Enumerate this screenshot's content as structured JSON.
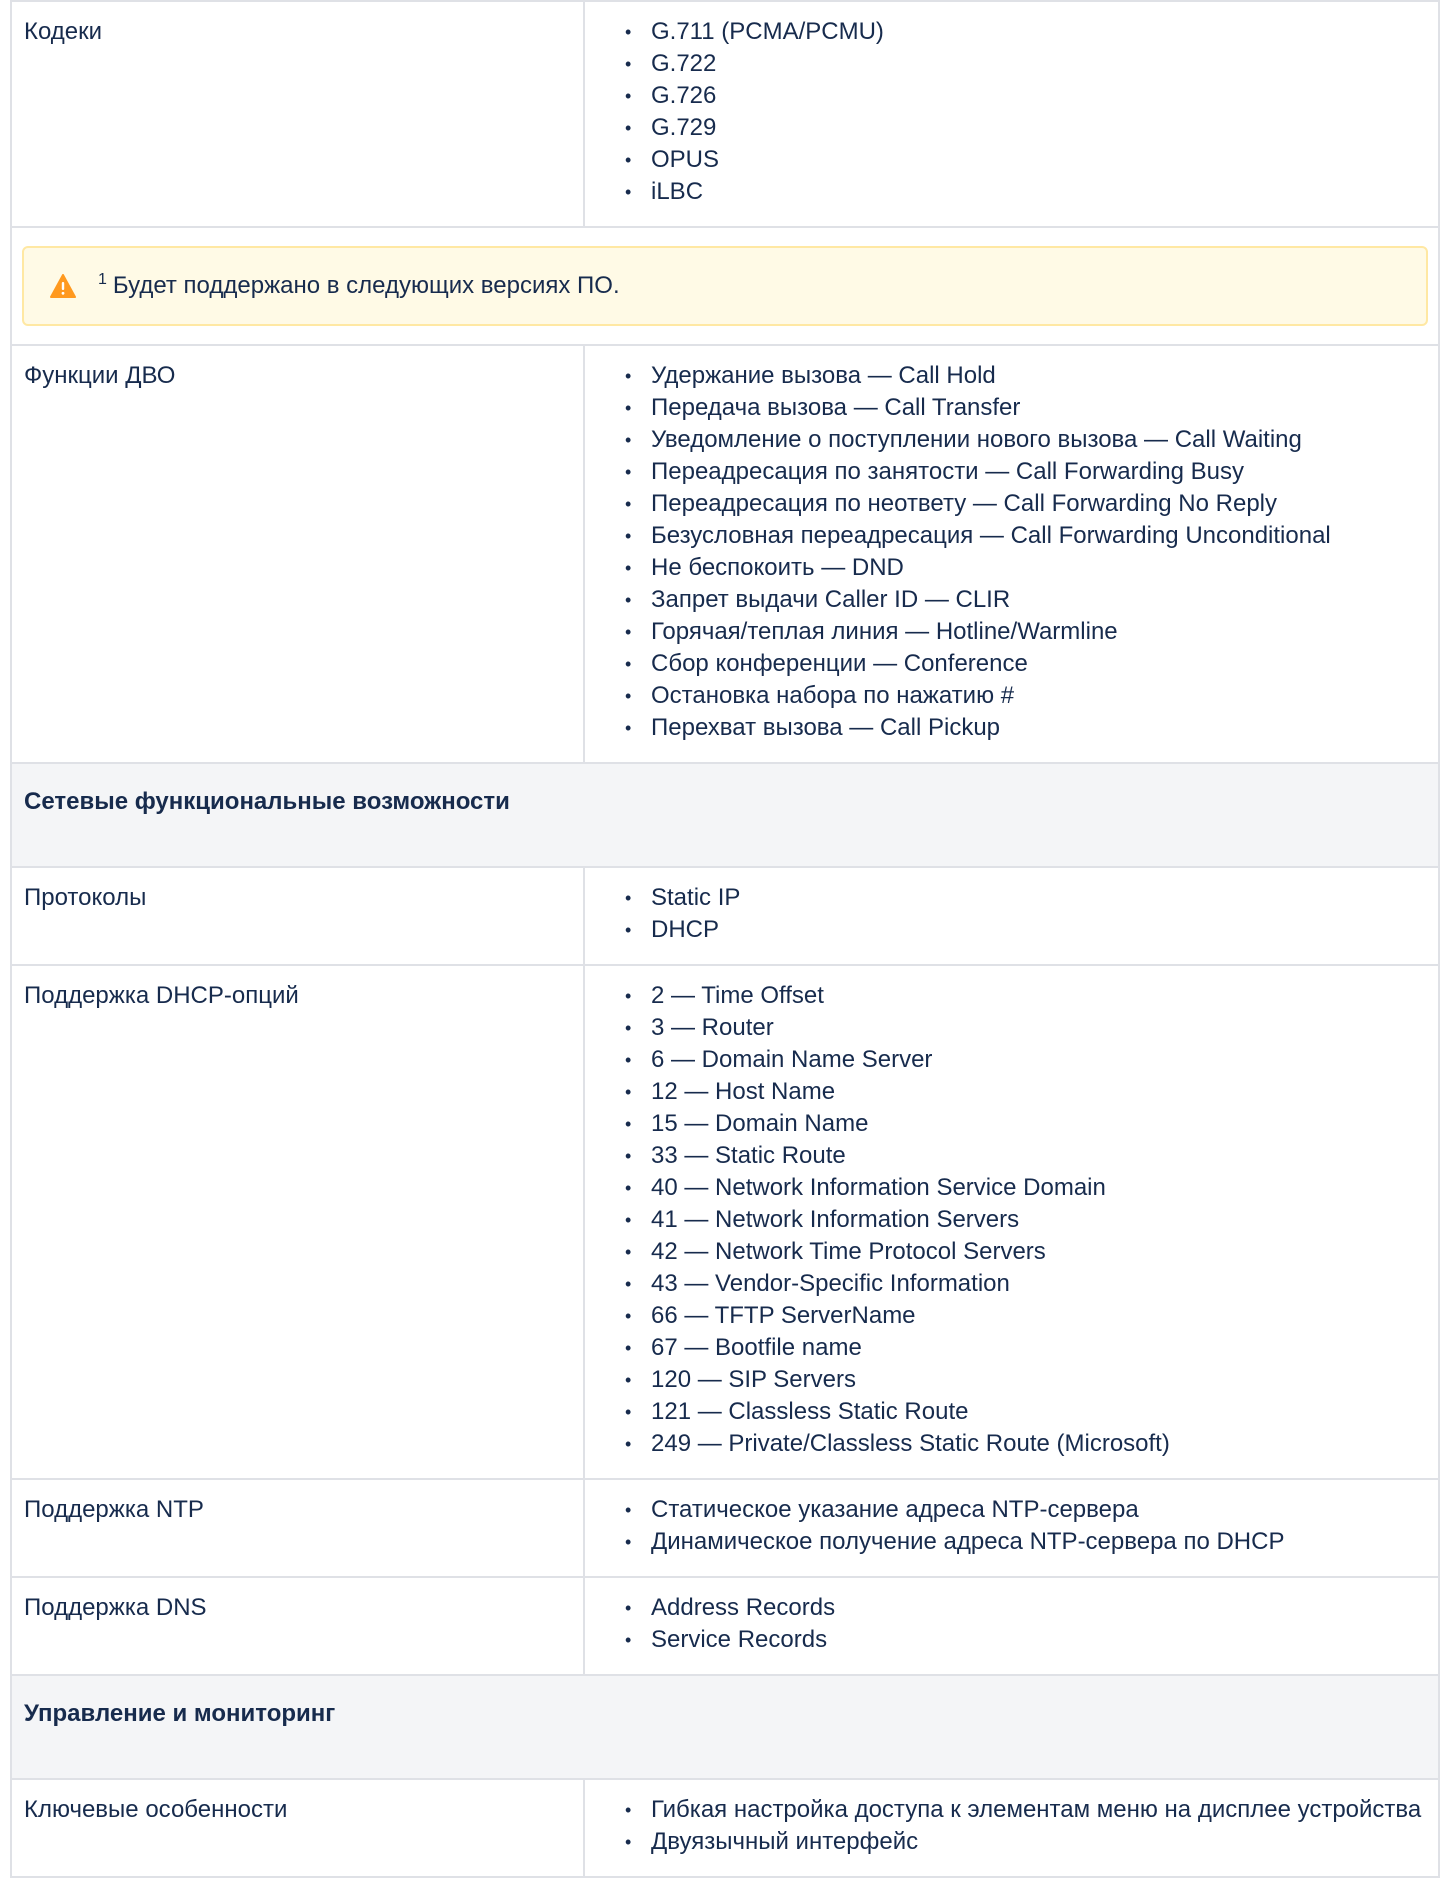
{
  "codecs": {
    "label": "Кодеки",
    "items": [
      "G.711 (PCMA/PCMU)",
      "G.722",
      "G.726",
      "G.729",
      "OPUS",
      "iLBC"
    ]
  },
  "note": {
    "marker": "1",
    "text": "Будет поддержано в следующих версиях ПО.",
    "icon": "warning-icon",
    "icon_color": "#ff991f",
    "background": "#fffae6"
  },
  "dvo": {
    "label": "Функции ДВО",
    "items": [
      "Удержание вызова — Call Hold",
      "Передача вызова — Call Transfer",
      "Уведомление о поступлении нового вызова — Call Waiting",
      "Переадресация по занятости — Call Forwarding Busy",
      "Переадресация по неответу — Call Forwarding No Reply",
      "Безусловная переадресация — Call Forwarding Unconditional",
      "Не беспокоить — DND",
      "Запрет выдачи Caller ID — CLIR",
      "Горячая/теплая линия — Hotline/Warmline",
      "Сбор конференции —  Conference",
      "Остановка набора по нажатию #",
      "Перехват вызова — Call Pickup"
    ]
  },
  "network_section": {
    "title": "Сетевые функциональные возможности"
  },
  "protocols": {
    "label": "Протоколы",
    "items": [
      "Static IP",
      "DHCP"
    ]
  },
  "dhcp_options": {
    "label": "Поддержка DHCP-опций",
    "items": [
      "2 — Time Offset",
      "3 — Router",
      "6 — Domain Name Server",
      "12 — Host Name",
      "15 — Domain Name",
      "33 — Static Route",
      "40 — Network Information Service Domain",
      "41 — Network Information Servers",
      "42 — Network Time Protocol Servers",
      "43 — Vendor-Specific Information",
      "66 — TFTP ServerName",
      "67 — Bootfile name",
      "120 — SIP Servers",
      "121 — Classless Static Route",
      "249 — Private/Classless Static Route (Microsoft)"
    ]
  },
  "ntp": {
    "label": "Поддержка NTP",
    "items": [
      "Статическое указание адреса NTP-сервера",
      "Динамическое получение адреса NTP-сервера по DHCP"
    ]
  },
  "dns": {
    "label": "Поддержка DNS",
    "items": [
      "Address Records",
      "Service Records"
    ]
  },
  "management_section": {
    "title": "Управление и мониторинг"
  },
  "key_features": {
    "label": "Ключевые особенности",
    "items": [
      "Гибкая настройка доступа к элементам меню на дисплее устройства",
      "Двуязычный интерфейс"
    ]
  }
}
